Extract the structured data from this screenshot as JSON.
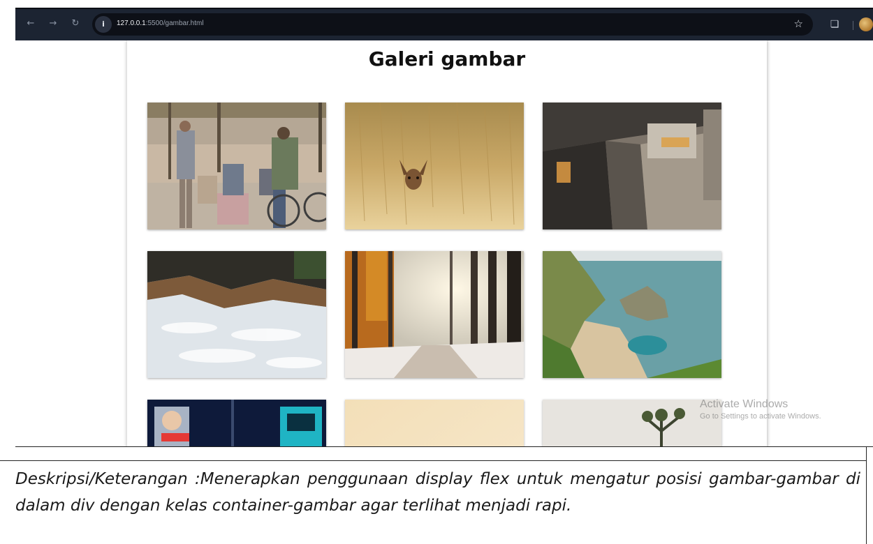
{
  "browser": {
    "url_host": "127.0.0.1",
    "url_rest": ":5500/gambar.html"
  },
  "page": {
    "title": "Galeri gambar",
    "images": [
      {
        "subject": "men-with-bicycles"
      },
      {
        "subject": "deer-in-wheat-field"
      },
      {
        "subject": "concrete-corridor"
      },
      {
        "subject": "aerial-waves"
      },
      {
        "subject": "snowy-autumn-forest-road"
      },
      {
        "subject": "coastal-cliffs"
      },
      {
        "subject": "neon-city-night"
      },
      {
        "subject": "beige-gradient"
      },
      {
        "subject": "joshua-tree"
      }
    ]
  },
  "windows_watermark": {
    "title": "Activate Windows",
    "subtitle": "Go to Settings to activate Windows."
  },
  "document": {
    "description": "Deskripsi/Keterangan :Menerapkan penggunaan display flex untuk mengatur posisi gambar-gambar di dalam div dengan kelas container-gambar agar terlihat menjadi rapi."
  },
  "colors": {
    "browser_bar": "#1c2432",
    "omnibox": "#0d1017"
  }
}
